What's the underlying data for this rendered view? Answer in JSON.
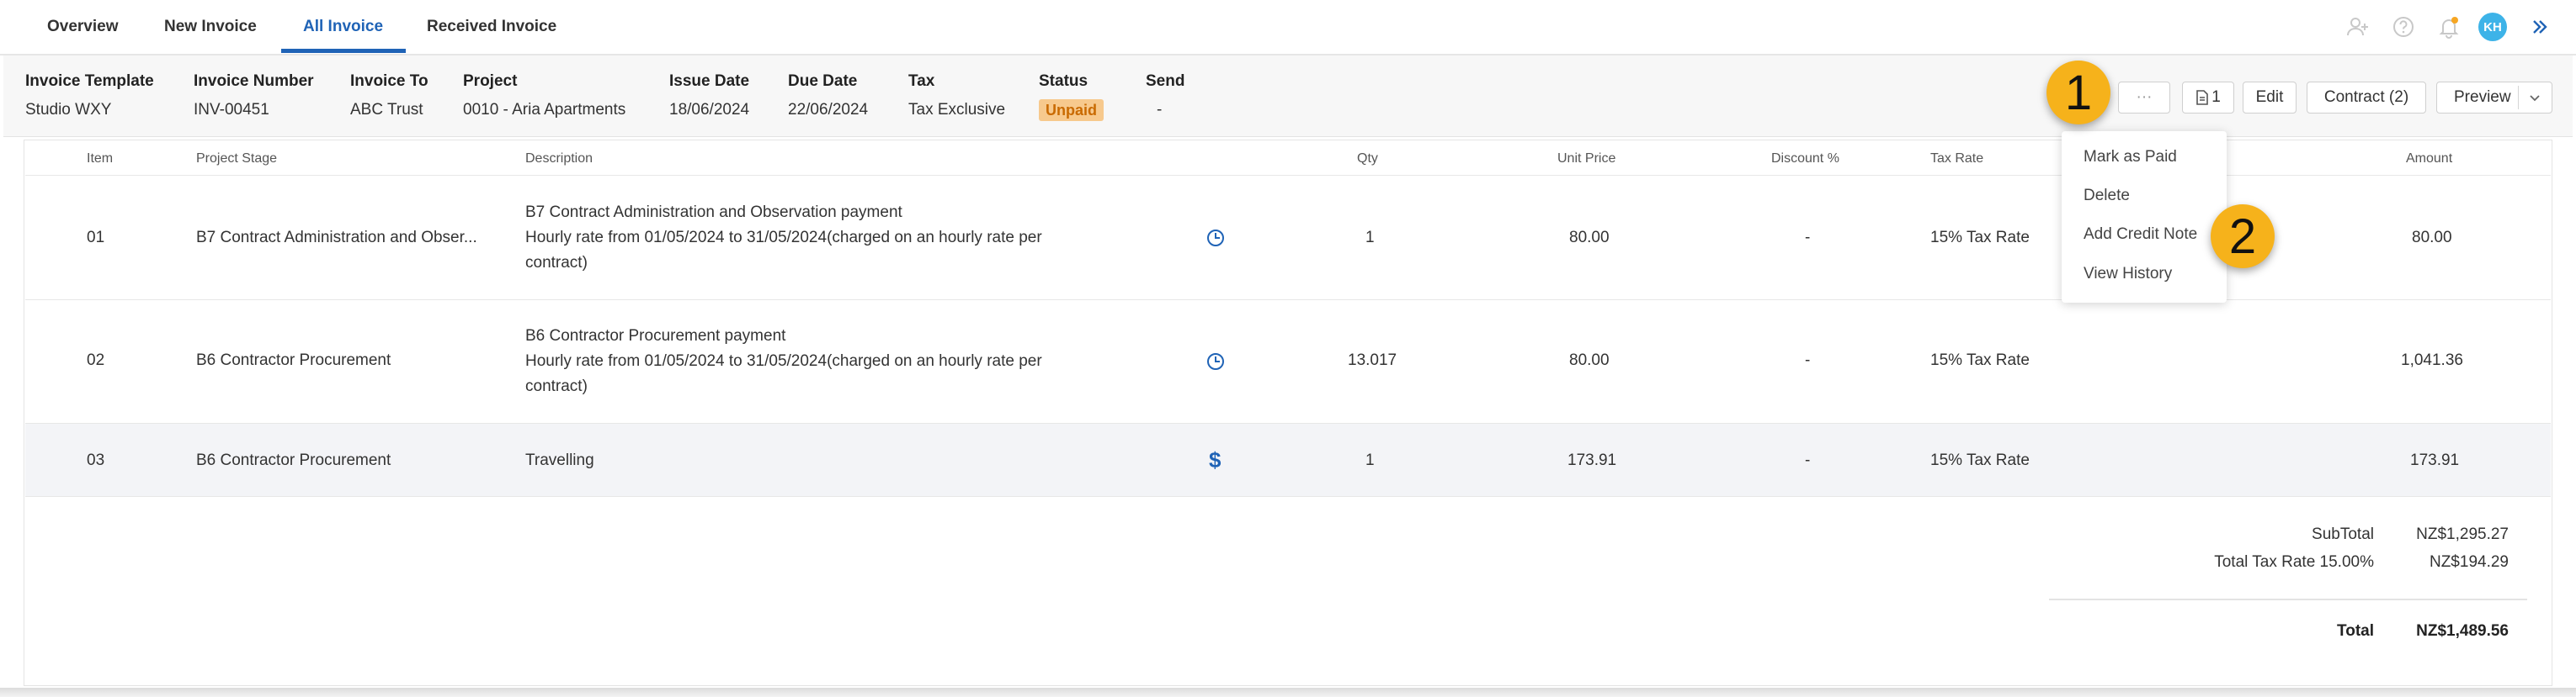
{
  "tabs": [
    {
      "label": "Overview"
    },
    {
      "label": "New Invoice"
    },
    {
      "label": "All Invoice"
    },
    {
      "label": "Received Invoice"
    }
  ],
  "user": {
    "initials": "KH"
  },
  "invoice": {
    "template_label": "Invoice Template",
    "template_value": "Studio WXY",
    "number_label": "Invoice Number",
    "number_value": "INV-00451",
    "to_label": "Invoice To",
    "to_value": "ABC Trust",
    "project_label": "Project",
    "project_value": "0010 - Aria Apartments",
    "issue_label": "Issue Date",
    "issue_value": "18/06/2024",
    "due_label": "Due Date",
    "due_value": "22/06/2024",
    "tax_label": "Tax",
    "tax_value": "Tax Exclusive",
    "status_label": "Status",
    "status_value": "Unpaid",
    "send_label": "Send",
    "send_value": "-"
  },
  "toolbar": {
    "more_label": "···",
    "attach_count": "1",
    "edit_label": "Edit",
    "contract_label": "Contract (2)",
    "preview_label": "Preview"
  },
  "menu": {
    "items": [
      "Mark as Paid",
      "Delete",
      "Add Credit Note",
      "View History"
    ]
  },
  "callouts": [
    "1",
    "2"
  ],
  "table": {
    "headers": {
      "item": "Item",
      "stage": "Project Stage",
      "description": "Description",
      "qty": "Qty",
      "unit_price": "Unit Price",
      "discount": "Discount %",
      "tax_rate": "Tax Rate",
      "amount": "Amount"
    },
    "rows": [
      {
        "item": "01",
        "stage": "B7 Contract Administration and Obser...",
        "desc1": "B7 Contract Administration and Observation payment",
        "desc2": "Hourly rate  from 01/05/2024 to 31/05/2024(charged on an hourly rate per",
        "desc3": "contract)",
        "type_icon": "clock-icon",
        "qty": "1",
        "unit_price": "80.00",
        "discount": "-",
        "tax_rate": "15% Tax Rate",
        "amount": "80.00"
      },
      {
        "item": "02",
        "stage": "B6 Contractor Procurement",
        "desc1": "B6 Contractor Procurement payment",
        "desc2": "Hourly rate  from 01/05/2024 to 31/05/2024(charged on an hourly rate per",
        "desc3": "contract)",
        "type_icon": "clock-icon",
        "qty": "13.017",
        "unit_price": "80.00",
        "discount": "-",
        "tax_rate": "15% Tax Rate",
        "amount": "1,041.36"
      },
      {
        "item": "03",
        "stage": "B6 Contractor Procurement",
        "desc1": "Travelling",
        "type_icon": "dollar-icon",
        "type_glyph": "$",
        "qty": "1",
        "unit_price": "173.91",
        "discount": "-",
        "tax_rate": "15% Tax Rate",
        "amount": "173.91"
      }
    ]
  },
  "totals": {
    "subtotal_label": "SubTotal",
    "subtotal_value": "NZ$1,295.27",
    "tax_label": "Total Tax Rate 15.00%",
    "tax_value": "NZ$194.29",
    "total_label": "Total",
    "total_value": "NZ$1,489.56"
  },
  "colors": {
    "accent": "#1f63b6",
    "status_unpaid_bg": "#f7c98d",
    "status_unpaid_text": "#c96a00",
    "callout": "#f6b21b",
    "avatar": "#3db3e8"
  }
}
